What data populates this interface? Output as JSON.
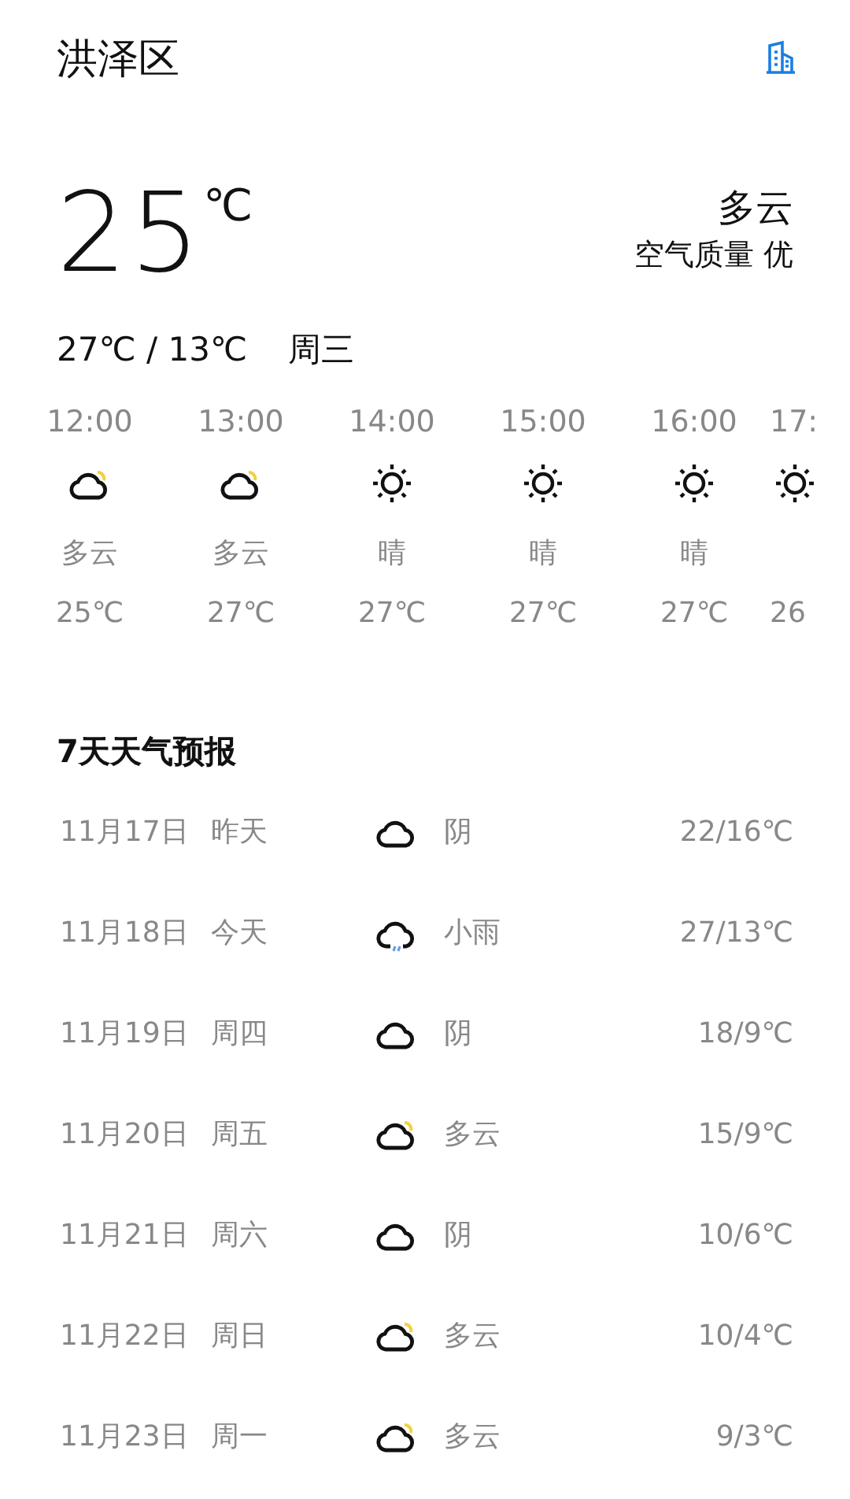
{
  "header": {
    "title": "洪泽区"
  },
  "current": {
    "temperature": "25",
    "unit": "℃",
    "condition": "多云",
    "air_quality": "空气质量 优",
    "range": "27℃ / 13℃",
    "weekday": "周三"
  },
  "hourly": [
    {
      "time": "12:00",
      "kind": "cloudy",
      "condition": "多云",
      "temp": "25℃"
    },
    {
      "time": "13:00",
      "kind": "cloudy",
      "condition": "多云",
      "temp": "27℃"
    },
    {
      "time": "14:00",
      "kind": "sunny",
      "condition": "晴",
      "temp": "27℃"
    },
    {
      "time": "15:00",
      "kind": "sunny",
      "condition": "晴",
      "temp": "27℃"
    },
    {
      "time": "16:00",
      "kind": "sunny",
      "condition": "晴",
      "temp": "27℃"
    },
    {
      "time": "17:",
      "kind": "sunny",
      "temp": "26"
    }
  ],
  "forecast": {
    "title": "7天天气预报",
    "days": [
      {
        "date": "11月17日",
        "day": "昨天",
        "kind": "overcast",
        "condition": "阴",
        "temps": "22/16℃"
      },
      {
        "date": "11月18日",
        "day": "今天",
        "kind": "rain",
        "condition": "小雨",
        "temps": "27/13℃"
      },
      {
        "date": "11月19日",
        "day": "周四",
        "kind": "overcast",
        "condition": "阴",
        "temps": "18/9℃"
      },
      {
        "date": "11月20日",
        "day": "周五",
        "kind": "cloudy",
        "condition": "多云",
        "temps": "15/9℃"
      },
      {
        "date": "11月21日",
        "day": "周六",
        "kind": "overcast",
        "condition": "阴",
        "temps": "10/6℃"
      },
      {
        "date": "11月22日",
        "day": "周日",
        "kind": "cloudy",
        "condition": "多云",
        "temps": "10/4℃"
      },
      {
        "date": "11月23日",
        "day": "周一",
        "kind": "cloudy",
        "condition": "多云",
        "temps": "9/3℃"
      }
    ]
  }
}
